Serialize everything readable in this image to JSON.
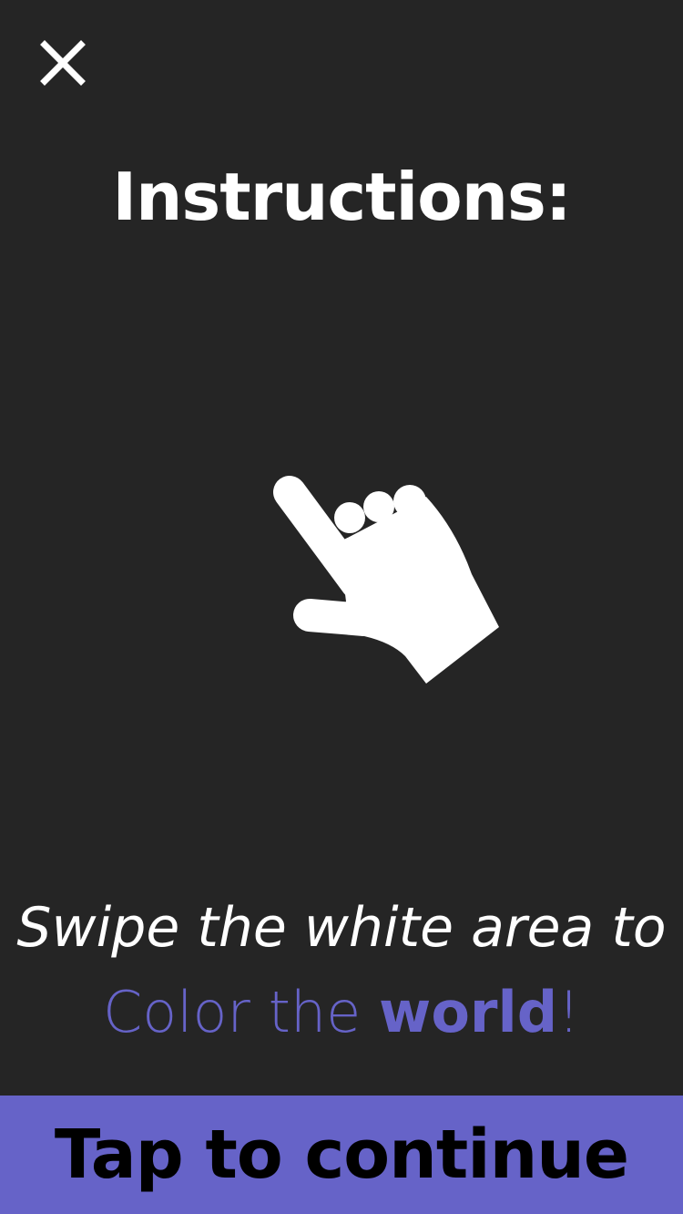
{
  "colors": {
    "background": "#252525",
    "accent": "#6663c8",
    "text": "#ffffff",
    "button_text": "#000000"
  },
  "header": {
    "close_icon": "close-icon"
  },
  "main": {
    "title": "Instructions:",
    "illustration_icon": "swipe-hand-icon",
    "line1": "Swipe the white area to",
    "line2_part1": "Color the ",
    "line2_bold": "world",
    "line2_end": "!"
  },
  "footer": {
    "continue_label": "Tap to continue"
  }
}
